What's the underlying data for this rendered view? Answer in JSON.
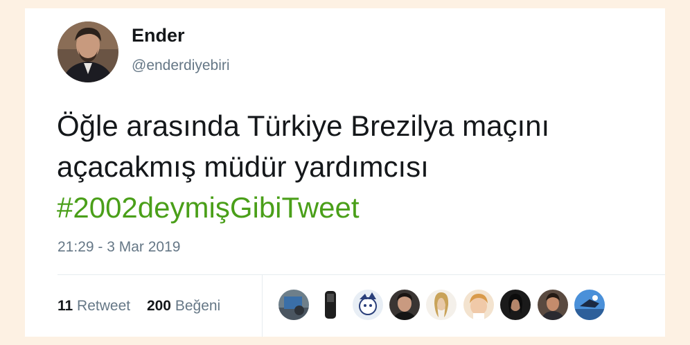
{
  "user": {
    "name": "Ender",
    "handle": "@enderdiyebiri"
  },
  "tweet": {
    "line1": "Öğle arasında Türkiye Brezilya maçını",
    "line2": "açacakmış müdür yardımcısı",
    "hashtag": "#2002deymişGibiTweet",
    "timestamp": "21:29 - 3 Mar 2019"
  },
  "stats": {
    "retweets_count": "11",
    "retweets_label": "Retweet",
    "likes_count": "200",
    "likes_label": "Beğeni"
  },
  "colors": {
    "hashtag": "#4a9f19",
    "secondary_text": "#657786",
    "primary_text": "#14171a",
    "page_background": "#fdf1e3"
  }
}
